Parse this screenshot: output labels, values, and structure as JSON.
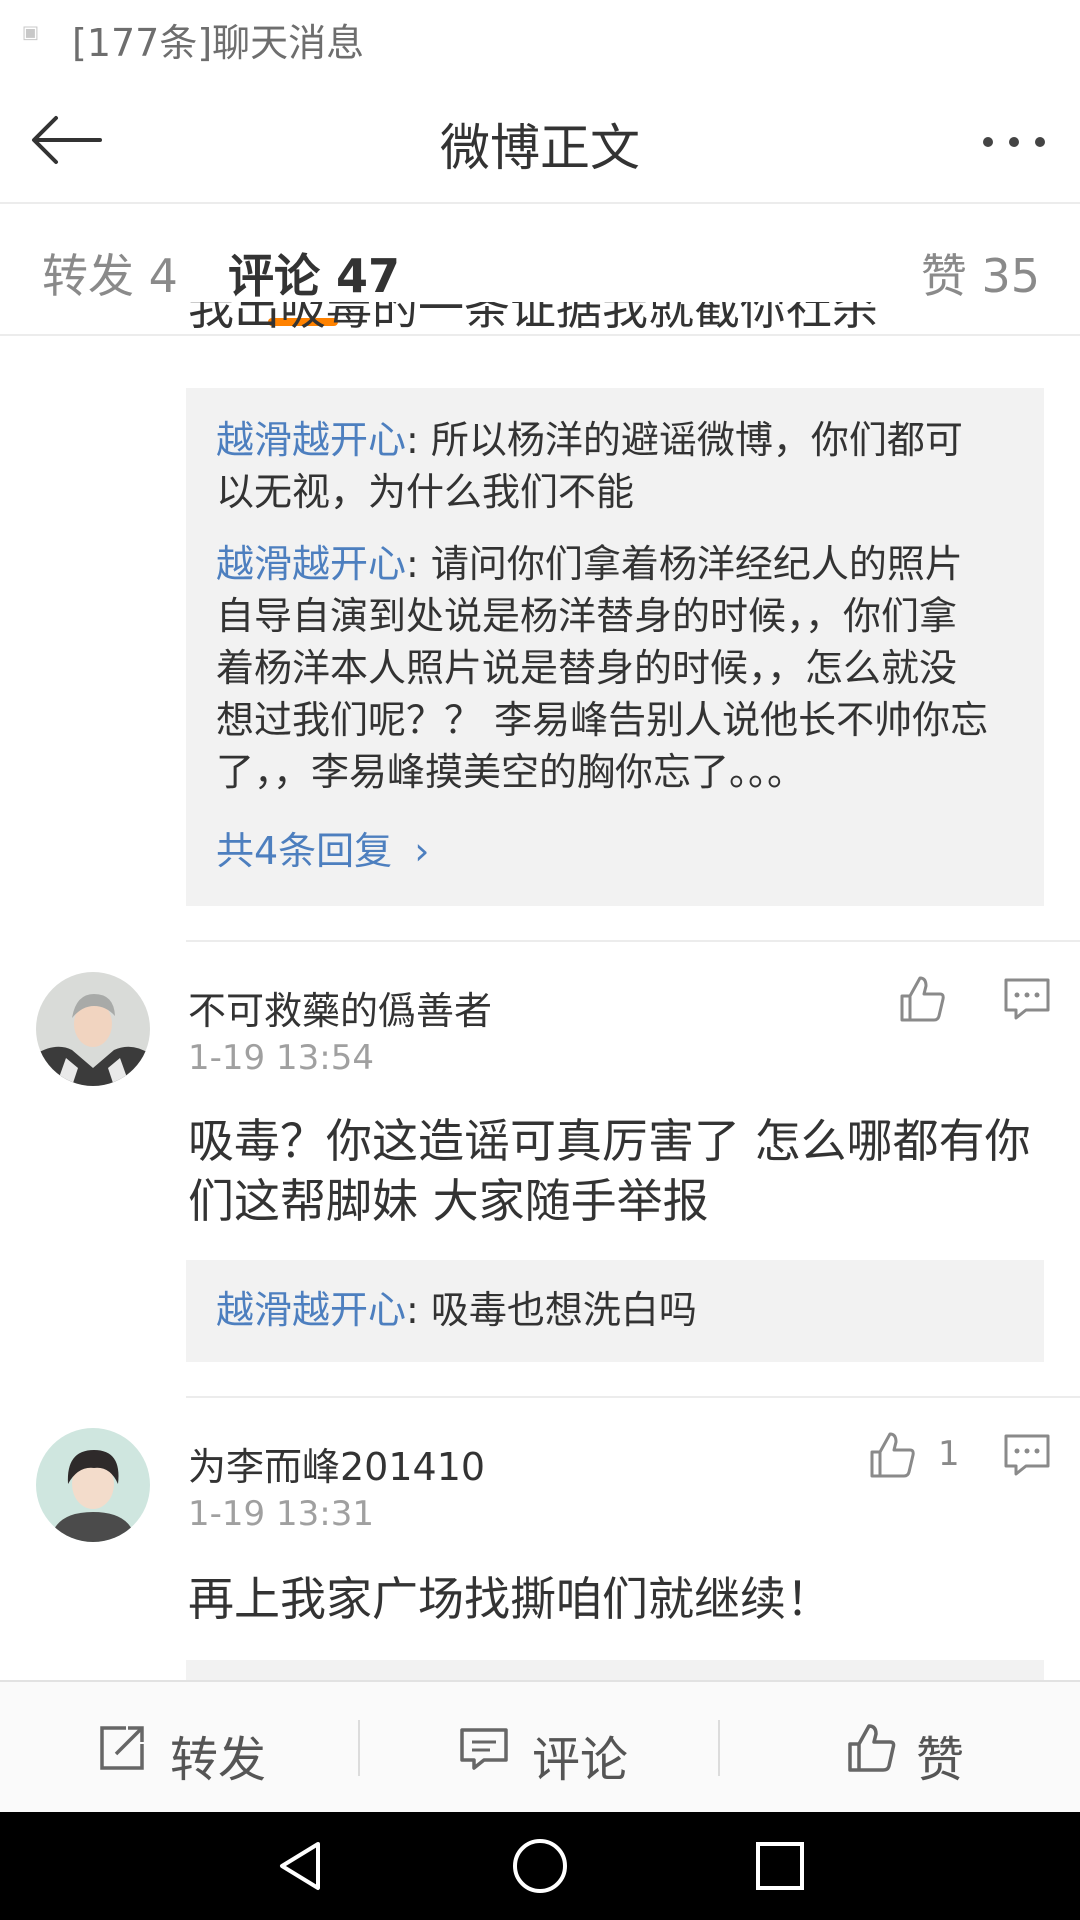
{
  "status_bar": {
    "notification_text": "[177条]聊天消息"
  },
  "header": {
    "title": "微博正文"
  },
  "tabs": {
    "repost": "转发 4",
    "comment": "评论 47",
    "like": "赞 35"
  },
  "partial_line": "我出吸毒的一条证据我就截你社杀",
  "thread1": {
    "replies": [
      {
        "author": "越滑越开心",
        "line1": ": 所以杨洋的避谣微博，你们都可",
        "line2": "以无视，为什么我们不能"
      },
      {
        "author": "越滑越开心",
        "line1": ": 请问你们拿着杨洋经纪人的照片",
        "line2": "自导自演到处说是杨洋替身的时候，，你们拿",
        "line3": "着杨洋本人照片说是替身的时候，，怎么就没",
        "line4": "想过我们呢？？ 李易峰告别人说他长不帅你忘",
        "line5": "了，，李易峰摸美空的胸你忘了。。。"
      }
    ],
    "more_replies": "共4条回复"
  },
  "comment1": {
    "username": "不可救藥的僞善者",
    "time": "1-19 13:54",
    "text_line1": "吸毒？你这造谣可真厉害了 怎么哪都有你",
    "text_line2": "们这帮脚妹 大家随手举报",
    "reply": {
      "author": "越滑越开心",
      "text": ": 吸毒也想洗白吗"
    }
  },
  "comment2": {
    "username": "为李而峰201410",
    "time": "1-19 13:31",
    "like_count": "1",
    "text": "再上我家广场找撕咱们就继续！"
  },
  "action_bar": {
    "repost": "转发",
    "comment": "评论",
    "like": "赞"
  },
  "colors": {
    "accent": "#ff8200",
    "link": "#4d7fbf"
  }
}
